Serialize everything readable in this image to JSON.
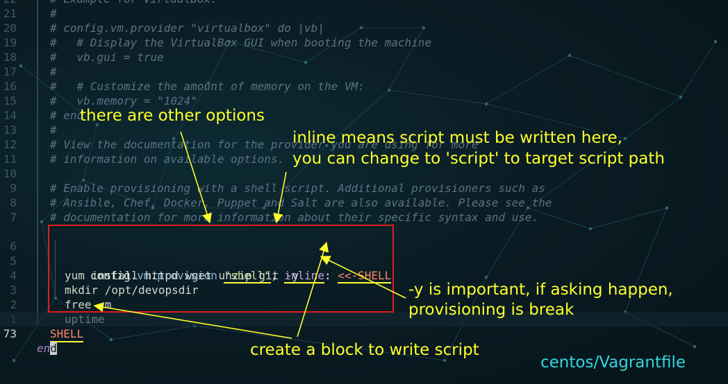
{
  "editor": {
    "lines": [
      {
        "num": "22",
        "text": "# Example for VirtualBox:"
      },
      {
        "num": "21",
        "text": "#"
      },
      {
        "num": "20",
        "text": "# config.vm.provider \"virtualbox\" do |vb|"
      },
      {
        "num": "19",
        "text": "#   # Display the VirtualBox GUI when booting the machine"
      },
      {
        "num": "18",
        "text": "#   vb.gui = true"
      },
      {
        "num": "17",
        "text": "#"
      },
      {
        "num": "16",
        "text": "#   # Customize the amount of memory on the VM:"
      },
      {
        "num": "15",
        "text": "#   vb.memory = \"1024\""
      },
      {
        "num": "14",
        "text": "# end"
      },
      {
        "num": "13",
        "text": "#"
      },
      {
        "num": "12",
        "text": "# View the documentation for the provider you are using for more"
      },
      {
        "num": "11",
        "text": "# information on available options."
      },
      {
        "num": "10",
        "text": ""
      },
      {
        "num": "9",
        "text": "# Enable provisioning with a shell script. Additional provisioners such as"
      },
      {
        "num": "8",
        "text": "# Ansible, Chef, Docker, Puppet and Salt are also available. Please see the"
      },
      {
        "num": "7",
        "text": "# documentation for more information about their specific syntax and use."
      }
    ],
    "provision": {
      "num": "6",
      "obj": "config",
      "dot1": ".",
      "vm": "vm",
      "dot2": ".",
      "method": "provision",
      "space": " ",
      "arg": "\"shell\"",
      "comma": ", ",
      "key": "inline",
      "colon": ": ",
      "heredoc": "<<-SHELL"
    },
    "script_lines": [
      {
        "num": "5",
        "text": "yum install httpd wget unzip git "
      },
      {
        "num": "4",
        "text": "mkdir /opt/devopsdir"
      },
      {
        "num": "3",
        "text": "free -m"
      },
      {
        "num": "2",
        "text": "uptime"
      }
    ],
    "yflag": "-y",
    "heredoc_end": {
      "num": "1",
      "text": "SHELL"
    },
    "current_line": {
      "num": "73",
      "text_start": "en",
      "text_cursor": "d"
    }
  },
  "annotations": {
    "other_options": "there are other options",
    "inline_line1": "inline means script must be written here,",
    "inline_line2": "you can change to 'script' to target script path",
    "y_line1": "-y is important, if asking happen,",
    "y_line2": "provisioning is break",
    "block": "create a block to write script"
  },
  "file_label": "centos/Vagrantfile",
  "colors": {
    "annotation": "#ffff2a",
    "box": "#e01e1e",
    "label": "#34d6e0",
    "background": "#0a1c24"
  }
}
